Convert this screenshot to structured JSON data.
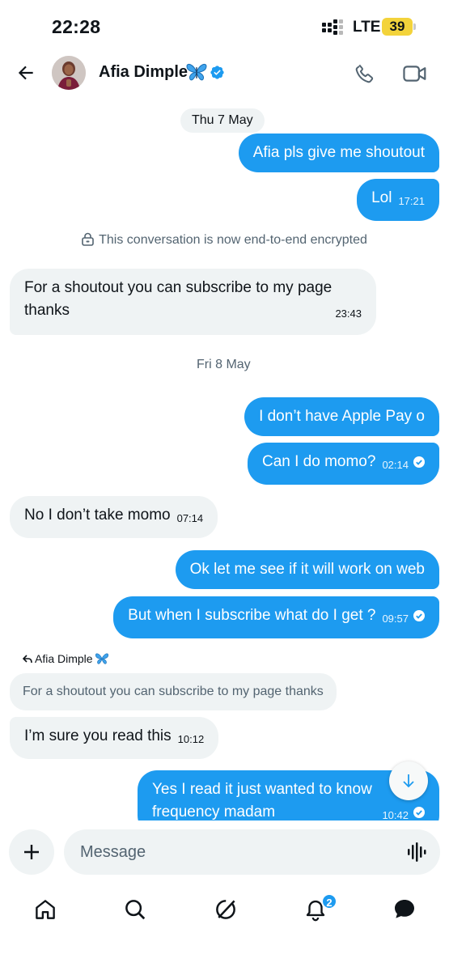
{
  "status_bar": {
    "time": "22:28",
    "network": "LTE",
    "battery": "39",
    "battery_color": "#f3d33b"
  },
  "header": {
    "back_icon": "arrow-left-icon",
    "contact_name": "Afia Dimple",
    "name_emoji": "butterfly-emoji",
    "verified": true,
    "call_icon": "phone-icon",
    "video_icon": "video-camera-icon"
  },
  "chat": {
    "date_1": "Thu 7 May",
    "encryption_note": "This conversation is now end-to-end encrypted",
    "date_2": "Fri 8 May",
    "messages": [
      {
        "direction": "out",
        "text": "Afia pls give me shoutout",
        "time": ""
      },
      {
        "direction": "out",
        "text": "Lol",
        "time": "17:21"
      },
      {
        "direction": "in",
        "text_line1": "For a shoutout you can subscribe to my page",
        "text_line2": "thanks",
        "time": "23:43"
      },
      {
        "direction": "out",
        "text": "I don’t have Apple Pay o",
        "time": ""
      },
      {
        "direction": "out",
        "text": "Can I do momo?",
        "time": "02:14",
        "read": true
      },
      {
        "direction": "in",
        "text": "No I don’t take momo",
        "time": "07:14"
      },
      {
        "direction": "out",
        "text": "Ok let me see if it will work on web",
        "time": ""
      },
      {
        "direction": "out",
        "text": "But when I subscribe what do I get ?",
        "time": "09:57",
        "read": true
      },
      {
        "direction": "in",
        "text": "I’m sure you read this",
        "time": "10:12"
      },
      {
        "direction": "out",
        "text_line1": "Yes I read it just wanted to know",
        "text_line2": "frequency madam",
        "time": "10:42",
        "read": true
      }
    ],
    "reply": {
      "author": "Afia Dimple",
      "quoted_text": "For a shoutout you can subscribe to my page thanks"
    }
  },
  "composer": {
    "placeholder": "Message",
    "add_icon": "plus-icon",
    "voice_icon": "voice-waveform-icon"
  },
  "bottom_nav": {
    "items": [
      "home-icon",
      "search-icon",
      "grok-icon",
      "notifications-icon",
      "messages-icon"
    ],
    "notifications_badge": "2"
  },
  "colors": {
    "accent": "#1d9bf0",
    "incoming_bubble": "#eff3f4",
    "secondary_text": "#536471"
  }
}
